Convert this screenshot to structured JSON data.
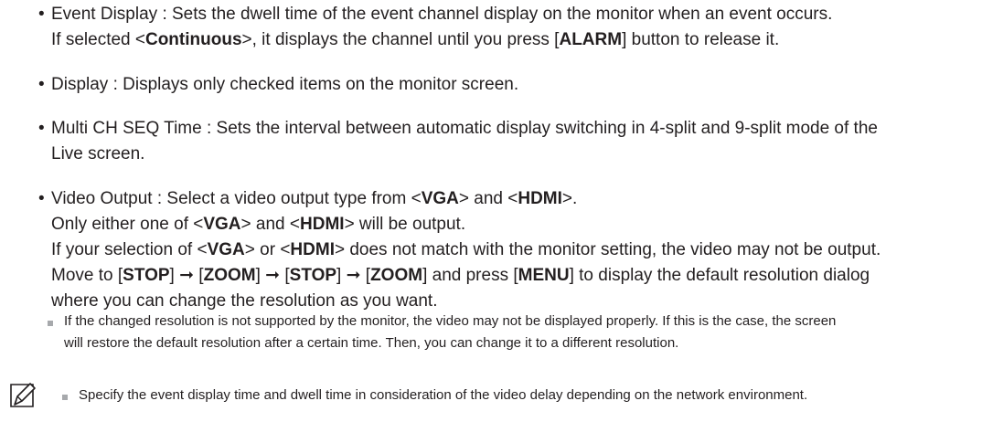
{
  "bullets": [
    {
      "label": "Event Display",
      "lines": [
        "Event Display : Sets the dwell time of the event channel display on the monitor when an event occurs.",
        "If selected <Continuous>, it displays the channel until you press [ALARM] button to release it."
      ]
    },
    {
      "label": "Display",
      "lines": [
        "Display : Displays only checked items on the monitor screen."
      ]
    },
    {
      "label": "Multi CH SEQ Time",
      "lines": [
        "Multi CH SEQ Time : Sets the interval between automatic display switching in 4-split and 9-split mode of the",
        "Live screen."
      ]
    },
    {
      "label": "Video Output",
      "lines": [
        "Video Output : Select a video output type from <VGA> and <HDMI>.",
        "Only either one of <VGA> and <HDMI> will be output.",
        "If your selection of <VGA> or <HDMI> does not match with the monitor setting, the video may not be output.",
        "Move to [STOP] ➞ [ZOOM] ➞ [STOP] ➞ [ZOOM] and press [MENU] to display the default resolution dialog",
        "where you can change the resolution as you want."
      ]
    }
  ],
  "sub_note": [
    "If the changed resolution is not supported by the monitor, the video may not be displayed properly. If this is the case, the screen",
    "will restore the default resolution after a certain time. Then, you can change it to a different resolution."
  ],
  "note": {
    "icon": "note-pen-icon",
    "text": "Specify the event display time and dwell time in consideration of the video delay depending on the network environment."
  },
  "colors": {
    "text": "#231f20",
    "note_square": "#a7a9ac"
  }
}
